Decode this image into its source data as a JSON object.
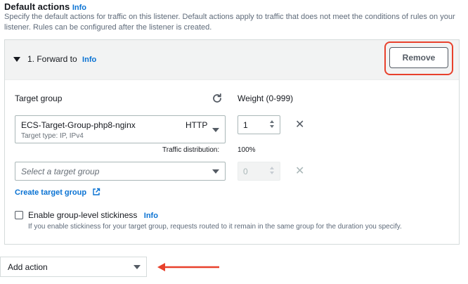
{
  "section": {
    "title": "Default actions",
    "info": "Info",
    "description": "Specify the default actions for traffic on this listener. Default actions apply to traffic that does not meet the conditions of rules on your listener. Rules can be configured after the listener is created."
  },
  "rule": {
    "title": "1. Forward to",
    "info": "Info",
    "remove_label": "Remove"
  },
  "target_group": {
    "label": "Target group",
    "weight_label": "Weight (0-999)",
    "selected_name": "ECS-Target-Group-php8-nginx",
    "selected_protocol": "HTTP",
    "selected_meta": "Target type: IP, IPv4",
    "weight_value": "1",
    "traffic_label": "Traffic distribution:",
    "traffic_value": "100%",
    "empty_placeholder": "Select a target group",
    "empty_weight": "0",
    "create_link": "Create target group"
  },
  "stickiness": {
    "label": "Enable group-level stickiness",
    "info": "Info",
    "description": "If you enable stickiness for your target group, requests routed to it remain in the same group for the duration you specify.",
    "checked": false
  },
  "add_action": {
    "label": "Add action"
  },
  "colors": {
    "link": "#0972d3",
    "highlight": "#e8412c",
    "arrow": "#e8412c"
  }
}
